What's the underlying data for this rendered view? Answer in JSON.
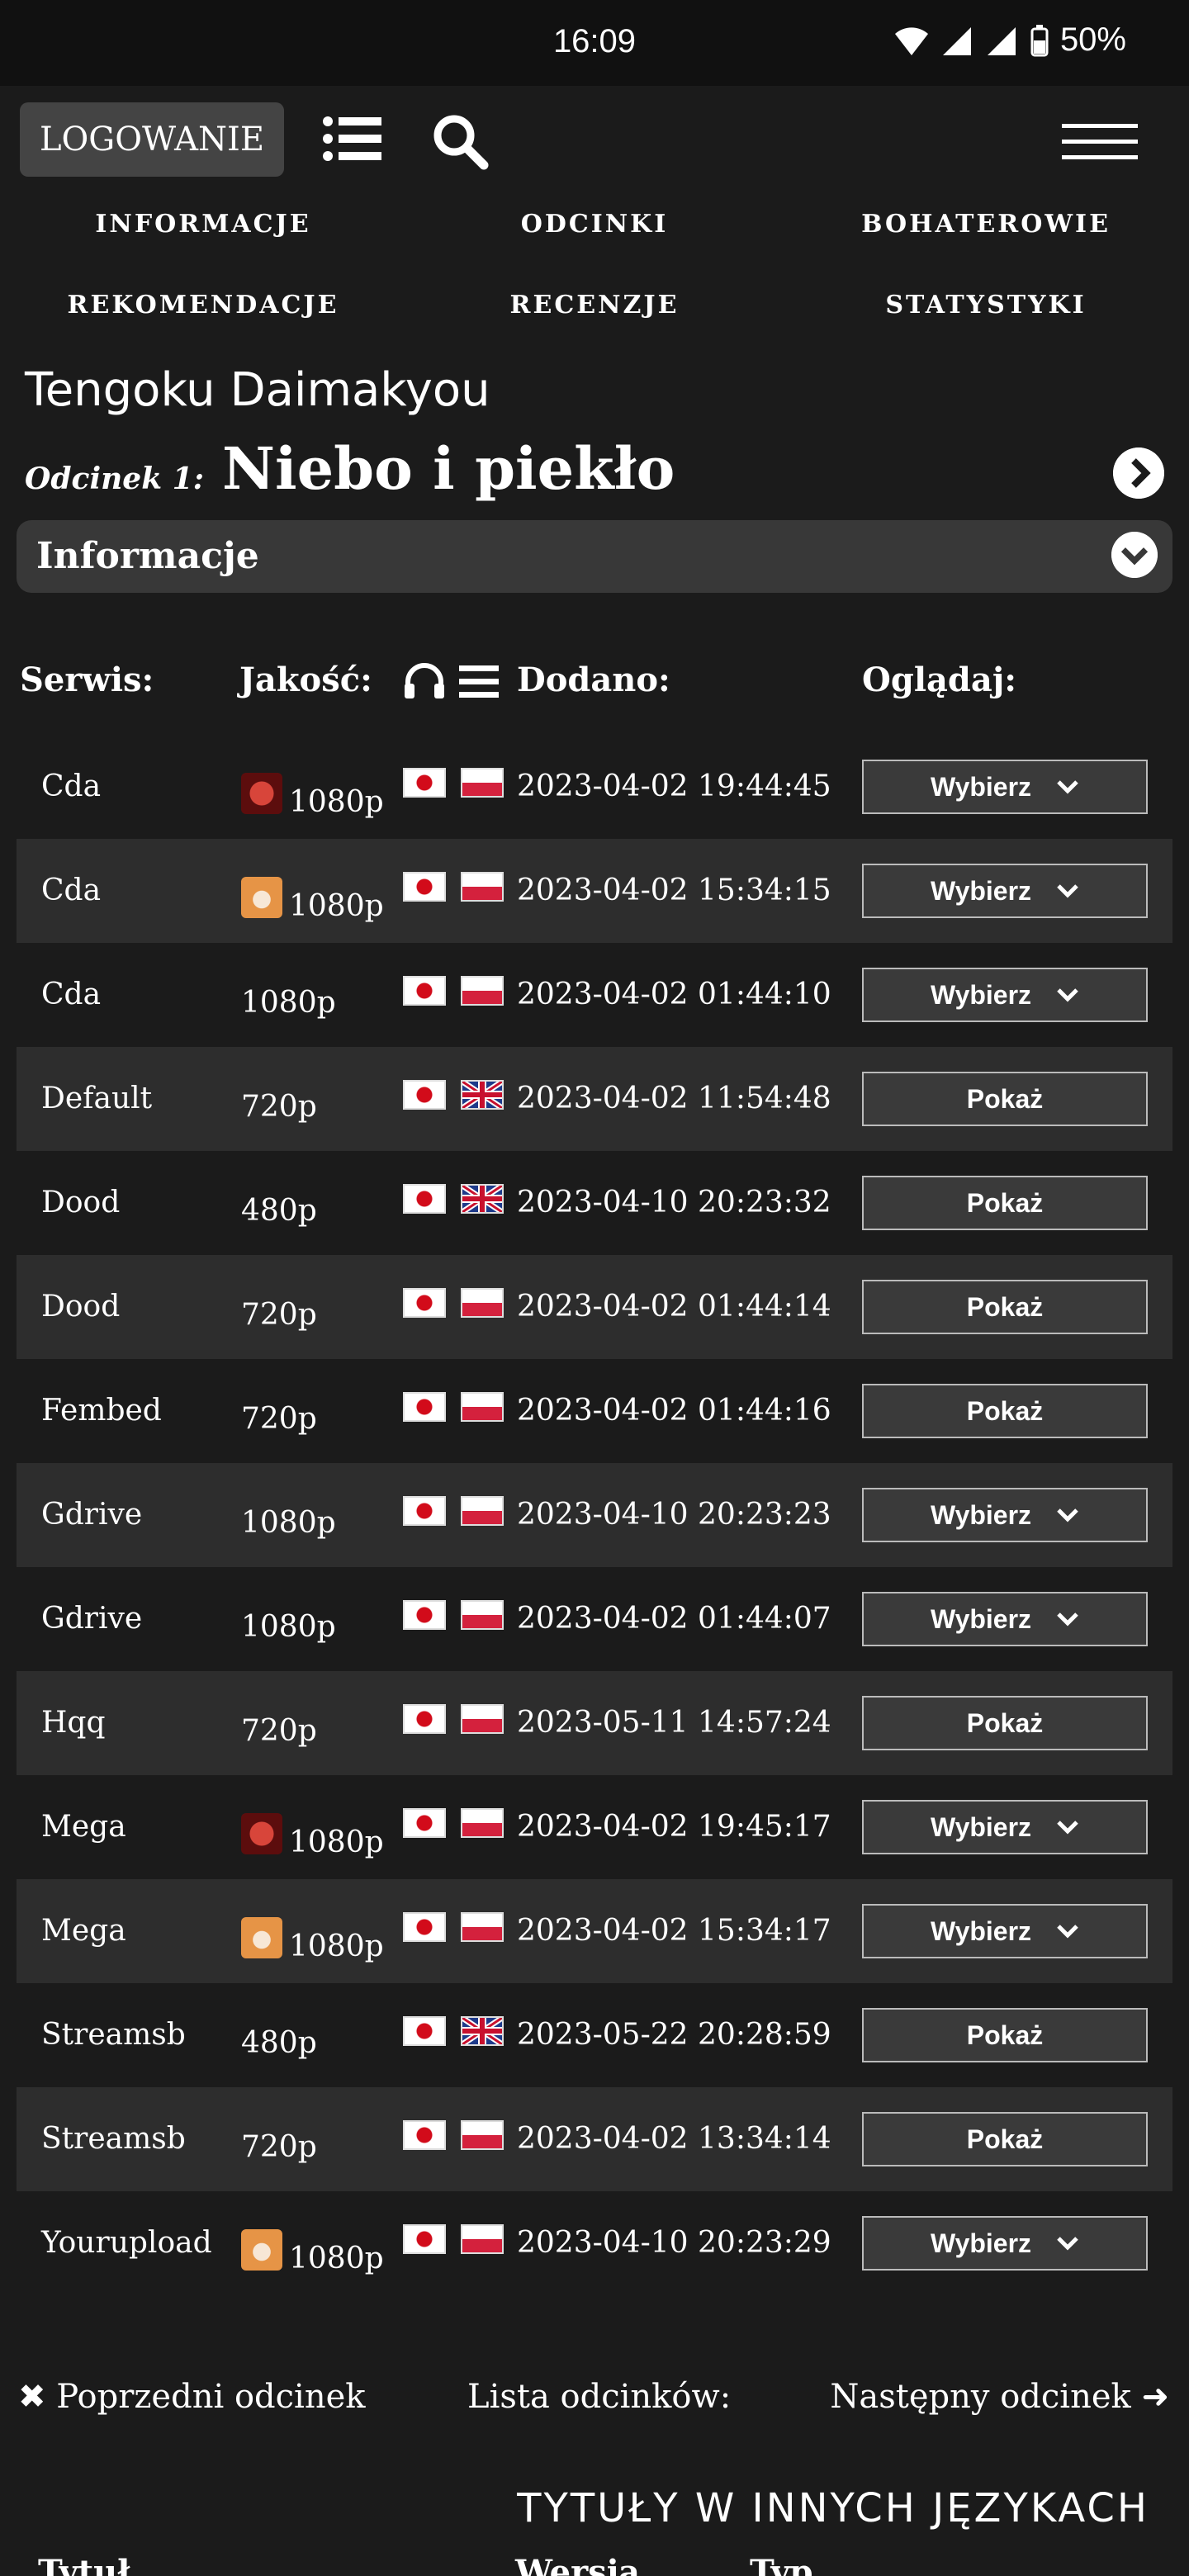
{
  "status_bar": {
    "time": "16:09",
    "battery": "50%"
  },
  "topbar": {
    "login_label": "LOGOWANIE"
  },
  "nav": {
    "items": [
      "INFORMACJE",
      "ODCINKI",
      "BOHATEROWIE",
      "REKOMENDACJE",
      "RECENZJE",
      "STATYSTYKI"
    ]
  },
  "anime": {
    "title": "Tengoku Daimakyou",
    "episode_label": "Odcinek 1:",
    "episode_title": "Niebo i piekło"
  },
  "info_section": {
    "label": "Informacje"
  },
  "table": {
    "headers": {
      "service": "Serwis:",
      "quality": "Jakość:",
      "added": "Dodano:",
      "watch": "Oglądaj:"
    },
    "rows": [
      {
        "service": "Cda",
        "badge": "red-group-icon",
        "quality": "1080p",
        "audio": "jp",
        "subs": "pl",
        "date": "2023-04-02 19:44:45",
        "action": "Wybierz",
        "dropdown": true
      },
      {
        "service": "Cda",
        "badge": "fox-group-icon",
        "quality": "1080p",
        "audio": "jp",
        "subs": "pl",
        "date": "2023-04-02 15:34:15",
        "action": "Wybierz",
        "dropdown": true
      },
      {
        "service": "Cda",
        "badge": "",
        "quality": "1080p",
        "audio": "jp",
        "subs": "pl",
        "date": "2023-04-02 01:44:10",
        "action": "Wybierz",
        "dropdown": true
      },
      {
        "service": "Default",
        "badge": "",
        "quality": "720p",
        "audio": "jp",
        "subs": "gb",
        "date": "2023-04-02 11:54:48",
        "action": "Pokaż",
        "dropdown": false
      },
      {
        "service": "Dood",
        "badge": "",
        "quality": "480p",
        "audio": "jp",
        "subs": "gb",
        "date": "2023-04-10 20:23:32",
        "action": "Pokaż",
        "dropdown": false
      },
      {
        "service": "Dood",
        "badge": "",
        "quality": "720p",
        "audio": "jp",
        "subs": "pl",
        "date": "2023-04-02 01:44:14",
        "action": "Pokaż",
        "dropdown": false
      },
      {
        "service": "Fembed",
        "badge": "",
        "quality": "720p",
        "audio": "jp",
        "subs": "pl",
        "date": "2023-04-02 01:44:16",
        "action": "Pokaż",
        "dropdown": false
      },
      {
        "service": "Gdrive",
        "badge": "",
        "quality": "1080p",
        "audio": "jp",
        "subs": "pl",
        "date": "2023-04-10 20:23:23",
        "action": "Wybierz",
        "dropdown": true
      },
      {
        "service": "Gdrive",
        "badge": "",
        "quality": "1080p",
        "audio": "jp",
        "subs": "pl",
        "date": "2023-04-02 01:44:07",
        "action": "Wybierz",
        "dropdown": true
      },
      {
        "service": "Hqq",
        "badge": "",
        "quality": "720p",
        "audio": "jp",
        "subs": "pl",
        "date": "2023-05-11 14:57:24",
        "action": "Pokaż",
        "dropdown": false
      },
      {
        "service": "Mega",
        "badge": "red-group-icon",
        "quality": "1080p",
        "audio": "jp",
        "subs": "pl",
        "date": "2023-04-02 19:45:17",
        "action": "Wybierz",
        "dropdown": true
      },
      {
        "service": "Mega",
        "badge": "fox-group-icon",
        "quality": "1080p",
        "audio": "jp",
        "subs": "pl",
        "date": "2023-04-02 15:34:17",
        "action": "Wybierz",
        "dropdown": true
      },
      {
        "service": "Streamsb",
        "badge": "",
        "quality": "480p",
        "audio": "jp",
        "subs": "gb",
        "date": "2023-05-22 20:28:59",
        "action": "Pokaż",
        "dropdown": false
      },
      {
        "service": "Streamsb",
        "badge": "",
        "quality": "720p",
        "audio": "jp",
        "subs": "pl",
        "date": "2023-04-02 13:34:14",
        "action": "Pokaż",
        "dropdown": false
      },
      {
        "service": "Yourupload",
        "badge": "fox-group-icon",
        "quality": "1080p",
        "audio": "jp",
        "subs": "pl",
        "date": "2023-04-10 20:23:29",
        "action": "Wybierz",
        "dropdown": true
      }
    ]
  },
  "footer_nav": {
    "prev": "Poprzedni odcinek",
    "list": "Lista odcinków:",
    "next": "Następny odcinek"
  },
  "other_titles": {
    "heading": "TYTUŁY W INNYCH JĘZYKACH",
    "columns": [
      "Tytuł",
      "Wersja",
      "Typ"
    ]
  },
  "colors": {
    "background": "#1b1b1b",
    "row_alt": "#2d2d2d",
    "button_bg": "#3a3a3a"
  }
}
